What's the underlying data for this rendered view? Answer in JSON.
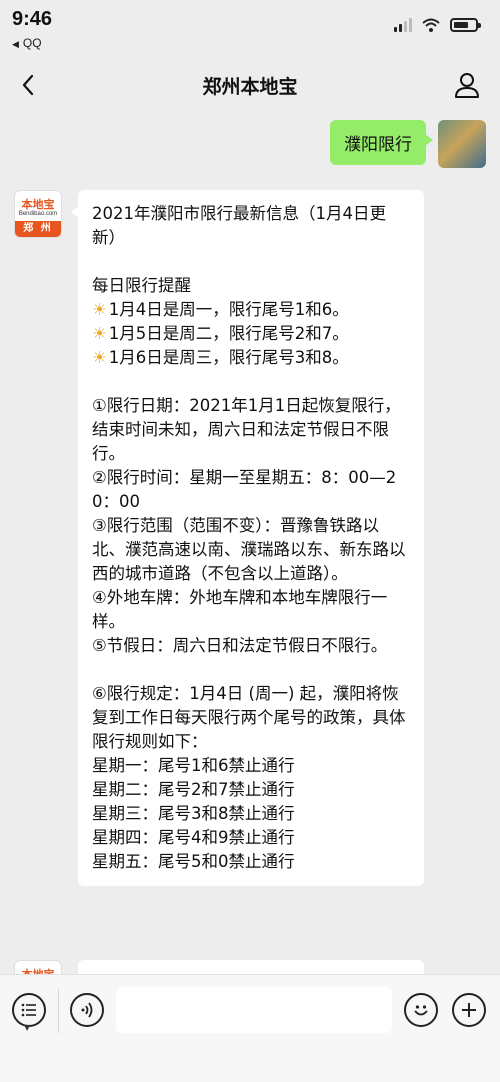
{
  "status_bar": {
    "time": "9:46",
    "back_app": "QQ",
    "back_arrow": "◀"
  },
  "nav": {
    "title": "郑州本地宝",
    "back_icon": "chevron-left-icon",
    "profile_icon": "person-icon"
  },
  "messages": {
    "outgoing": {
      "text": "濮阳限行"
    },
    "bot_avatar": {
      "brand": "本地宝",
      "url": "Bendibao.com",
      "city": "郑 州"
    },
    "incoming": {
      "lines": [
        "2021年濮阳市限行最新信息（1月4日更新）",
        "",
        "每日限行提醒",
        "1月4日是周一，限行尾号1和6。",
        "1月5日是周二，限行尾号2和7。",
        "1月6日是周三，限行尾号3和8。",
        "",
        "①限行日期：2021年1月1日起恢复限行，结束时间未知，周六日和法定节假日不限行。",
        "②限行时间：星期一至星期五：8：00—20：00",
        "③限行范围（范围不变）：晋豫鲁铁路以北、濮范高速以南、濮瑞路以东、新东路以西的城市道路（不包含以上道路）。",
        "④外地车牌：外地车牌和本地车牌限行一样。",
        "⑤节假日：周六日和法定节假日不限行。",
        "",
        "⑥限行规定：1月4日 (周一) 起，濮阳将恢复到工作日每天限行两个尾号的政策，具体限行规则如下：",
        "星期一：尾号1和6禁止通行",
        "星期二：尾号2和7禁止通行",
        "星期三：尾号3和8禁止通行",
        "星期四：尾号4和9禁止通行",
        "星期五：尾号5和0禁止通行"
      ]
    }
  },
  "input_bar": {
    "menu_icon": "menu-list-icon",
    "voice_icon": "voice-icon",
    "emoji_icon": "emoji-icon",
    "plus_icon": "plus-icon"
  }
}
